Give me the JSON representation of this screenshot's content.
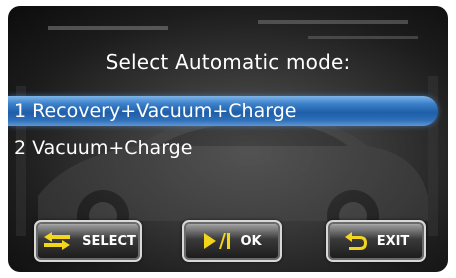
{
  "screen": {
    "title": "Select Automatic mode:",
    "menu": [
      {
        "label": "1 Recovery+Vacuum+Charge",
        "selected": true
      },
      {
        "label": "2 Vacuum+Charge",
        "selected": false
      }
    ]
  },
  "buttons": {
    "select": {
      "label": "SELECT",
      "icon": "swap-arrows-icon"
    },
    "ok": {
      "label": "OK",
      "icon": "play-pause-icon"
    },
    "exit": {
      "label": "EXIT",
      "icon": "back-arrow-icon"
    }
  },
  "colors": {
    "icon_yellow": "#f2d51c",
    "highlight_blue": "#1f5ea8",
    "text": "#ffffff"
  }
}
